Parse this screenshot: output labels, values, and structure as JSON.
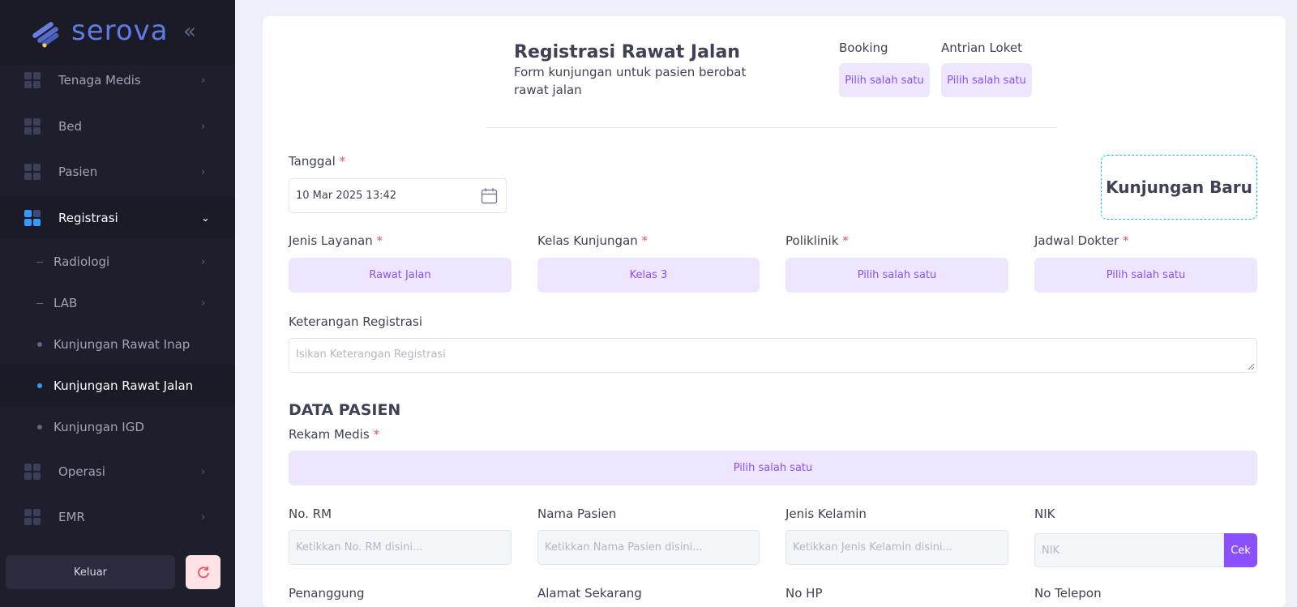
{
  "sidebar": {
    "logo_text": "serova",
    "collapse_glyph": "«",
    "menu": [
      {
        "label": "Tenaga Medis",
        "arrow": "›"
      },
      {
        "label": "Bed",
        "arrow": "›"
      },
      {
        "label": "Pasien",
        "arrow": "›"
      },
      {
        "label": "Registrasi",
        "arrow": "⌄"
      },
      {
        "label": "Operasi",
        "arrow": "›"
      },
      {
        "label": "EMR",
        "arrow": "›"
      }
    ],
    "submenu": [
      {
        "label": "Radiologi",
        "arrow": "›"
      },
      {
        "label": "LAB",
        "arrow": "›"
      },
      {
        "label": "Kunjungan Rawat Inap"
      },
      {
        "label": "Kunjungan Rawat Jalan"
      },
      {
        "label": "Kunjungan IGD"
      }
    ],
    "logout_label": "Keluar"
  },
  "header": {
    "title": "Registrasi Rawat Jalan",
    "subtitle": "Form kunjungan untuk pasien berobat rawat jalan",
    "booking_label": "Booking",
    "booking_value": "Pilih salah satu",
    "antrian_label": "Antrian Loket",
    "antrian_value": "Pilih salah satu"
  },
  "form": {
    "tanggal_label": "Tanggal",
    "required_mark": "*",
    "tanggal_value": "10 Mar 2025 13:42",
    "kunjungan_status": "Kunjungan Baru",
    "jenis_layanan_label": "Jenis Layanan",
    "jenis_layanan_value": "Rawat Jalan",
    "kelas_kunjungan_label": "Kelas Kunjungan",
    "kelas_kunjungan_value": "Kelas 3",
    "poliklinik_label": "Poliklinik",
    "poliklinik_value": "Pilih salah satu",
    "jadwal_dokter_label": "Jadwal Dokter",
    "jadwal_dokter_value": "Pilih salah satu",
    "keterangan_label": "Keterangan Registrasi",
    "keterangan_placeholder": "Isikan Keterangan Registrasi"
  },
  "pasien": {
    "section_title": "DATA PASIEN",
    "rekam_medis_label": "Rekam Medis",
    "rekam_medis_value": "Pilih salah satu",
    "no_rm_label": "No. RM",
    "no_rm_placeholder": "Ketikkan No. RM disini...",
    "nama_label": "Nama Pasien",
    "nama_placeholder": "Ketikkan Nama Pasien disini...",
    "jenis_kelamin_label": "Jenis Kelamin",
    "jenis_kelamin_placeholder": "Ketikkan Jenis Kelamin disini...",
    "nik_label": "NIK",
    "nik_placeholder": "NIK",
    "cek_label": "Cek",
    "penanggung_label": "Penanggung",
    "alamat_label": "Alamat Sekarang",
    "no_hp_label": "No HP",
    "no_telepon_label": "No Telepon"
  },
  "colors": {
    "sidebar_bg": "#1e1e2d",
    "accent_purple": "#8950fc",
    "select_bg": "#eee5ff",
    "active_blue": "#3699ff",
    "required_red": "#f64e60",
    "status_border": "#1bc5bd"
  }
}
